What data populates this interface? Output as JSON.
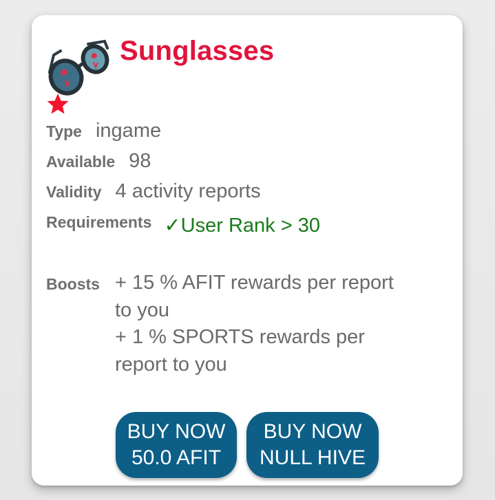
{
  "product": {
    "title": "Sunglasses",
    "image_icon": "sunglasses-icon",
    "rating_icon": "star-icon",
    "accent_color": "#e0143c"
  },
  "details": {
    "type_label": "Type",
    "type_value": "ingame",
    "available_label": "Available",
    "available_value": "98",
    "validity_label": "Validity",
    "validity_value": "4 activity reports",
    "requirements_label": "Requirements",
    "requirements_value": "✓User Rank > 30",
    "requirements_color": "#1a7a1a"
  },
  "boosts": {
    "label": "Boosts",
    "lines": [
      "+ 15 % AFIT rewards per report",
      "to you",
      "+ 1 % SPORTS rewards per",
      "report to you"
    ]
  },
  "buttons": {
    "buy_afit_line1": "BUY NOW",
    "buy_afit_line2": "50.0 AFIT",
    "buy_hive_line1": "BUY NOW",
    "buy_hive_line2": "NULL HIVE",
    "button_color": "#0d5f87"
  }
}
